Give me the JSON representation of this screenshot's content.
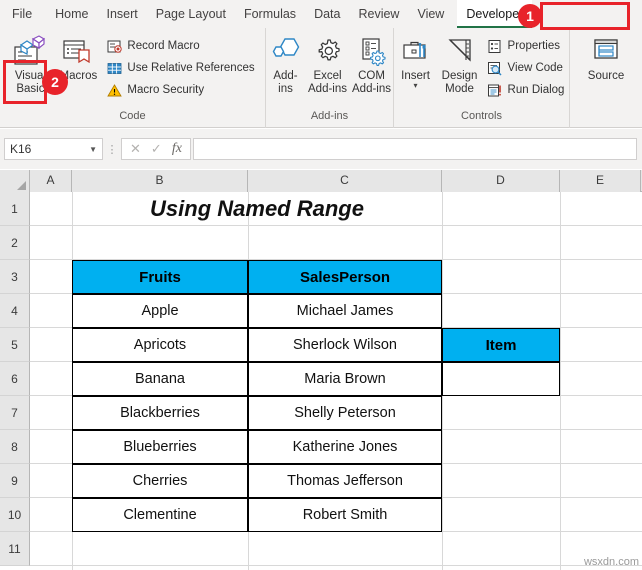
{
  "ribbon_tabs": [
    {
      "label": "File",
      "active": false
    },
    {
      "label": "Home",
      "active": false
    },
    {
      "label": "Insert",
      "active": false
    },
    {
      "label": "Page Layout",
      "active": false
    },
    {
      "label": "Formulas",
      "active": false
    },
    {
      "label": "Data",
      "active": false
    },
    {
      "label": "Review",
      "active": false
    },
    {
      "label": "View",
      "active": false
    },
    {
      "label": "Developer",
      "active": true
    }
  ],
  "groups": {
    "code": {
      "label": "Code",
      "visual_basic": "Visual\nBasic",
      "visual_basic_line1": "Visual",
      "visual_basic_line2": "Basic",
      "macros": "Macros",
      "record_macro": "Record Macro",
      "use_relative_references": "Use Relative References",
      "macro_security": "Macro Security"
    },
    "addins": {
      "label": "Add-ins",
      "addins_line1": "Add-",
      "addins_line2": "ins",
      "excel_line1": "Excel",
      "excel_line2": "Add-ins",
      "com_line1": "COM",
      "com_line2": "Add-ins"
    },
    "controls": {
      "label": "Controls",
      "insert": "Insert",
      "design_line1": "Design",
      "design_line2": "Mode",
      "properties": "Properties",
      "view_code": "View Code",
      "run_dialog": "Run Dialog"
    },
    "xml": {
      "label": "",
      "source": "Source"
    }
  },
  "formula_bar": {
    "name_box_value": "K16",
    "formula_value": "",
    "cancel_icon": "✕",
    "enter_icon": "✓",
    "function_icon": "fx"
  },
  "grid": {
    "columns": [
      "A",
      "B",
      "C",
      "D",
      "E"
    ],
    "rows": [
      "1",
      "2",
      "3",
      "4",
      "5",
      "6",
      "7",
      "8",
      "9",
      "10",
      "11"
    ],
    "title": "Using Named Range",
    "table_headers": [
      "Fruits",
      "SalesPerson"
    ],
    "table_rows": [
      [
        "Apple",
        "Michael James"
      ],
      [
        "Apricots",
        "Sherlock Wilson"
      ],
      [
        "Banana",
        "Maria Brown"
      ],
      [
        "Blackberries",
        "Shelly Peterson"
      ],
      [
        "Blueberries",
        "Katherine Jones"
      ],
      [
        "Cherries",
        "Thomas Jefferson"
      ],
      [
        "Clementine",
        "Robert Smith"
      ]
    ],
    "item_label": "Item",
    "item_value": ""
  },
  "annotations": {
    "marker_1": "1",
    "marker_2": "2"
  },
  "watermark": "wsxdn.com",
  "colors": {
    "header_fill": "#00b0f0",
    "annotation_red": "#e8232a",
    "tab_accent": "#217346",
    "ribbon_bg": "#f3f2f1"
  }
}
